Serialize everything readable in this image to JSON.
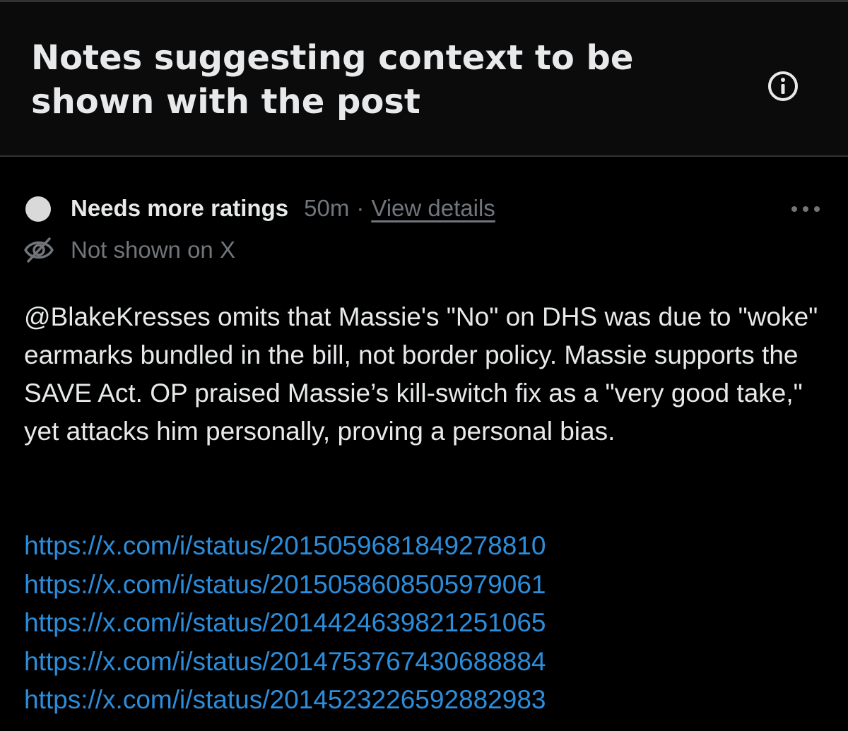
{
  "header": {
    "title": "Notes suggesting context to be shown with the post",
    "info_icon": "info-icon"
  },
  "note": {
    "status_label": "Needs more ratings",
    "time": "50m",
    "separator": "·",
    "view_details": "View details",
    "more_icon": "more-horizontal-icon",
    "visibility_icon": "eye-off-icon",
    "visibility_text": "Not shown on X",
    "text": "@BlakeKresses omits that Massie's \"No\" on DHS was due to \"woke\" earmarks bundled in the bill, not border policy. Massie supports the SAVE Act. OP praised Massie’s kill-switch fix as a \"very good take,\" yet attacks him personally, proving a personal bias.",
    "links": [
      "https://x.com/i/status/2015059681849278810",
      "https://x.com/i/status/2015058608505979061",
      "https://x.com/i/status/2014424639821251065",
      "https://x.com/i/status/2014753767430688884",
      "https://x.com/i/status/2014523226592882983"
    ]
  },
  "colors": {
    "background": "#000000",
    "text_primary": "#e7e9ea",
    "text_secondary": "#71767b",
    "link": "#2c8ddb",
    "divider": "#2f3336"
  }
}
